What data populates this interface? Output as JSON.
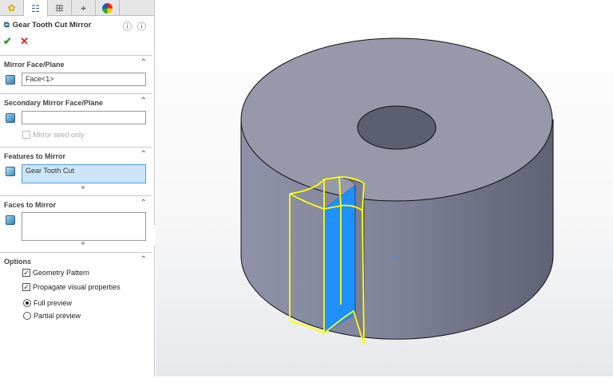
{
  "tabs": [
    {
      "name": "feature-manager",
      "icon": "gear-part-icon"
    },
    {
      "name": "property-manager",
      "icon": "list-icon",
      "active": true
    },
    {
      "name": "configuration-manager",
      "icon": "config-icon"
    },
    {
      "name": "dimxpert",
      "icon": "crosshair-icon"
    },
    {
      "name": "display-manager",
      "icon": "color-wheel-icon"
    }
  ],
  "title": "Gear Tooth Cut Mirror",
  "sections": {
    "mirror_face": {
      "header": "Mirror Face/Plane",
      "value": "Face<1>"
    },
    "secondary": {
      "header": "Secondary Mirror Face/Plane",
      "value": "",
      "option": "Mirror seed only"
    },
    "features": {
      "header": "Features to Mirror",
      "value": "Gear Tooth Cut"
    },
    "faces": {
      "header": "Faces to Mirror",
      "value": ""
    },
    "options": {
      "header": "Options",
      "geometry_pattern": "Geometry Pattern",
      "propagate": "Propagate visual properties",
      "full": "Full preview",
      "partial": "Partial preview"
    }
  },
  "state": {
    "geometry_pattern": true,
    "propagate": true,
    "mirror_seed_only": false,
    "preview": "full"
  },
  "colors": {
    "model": "#8a8d9e",
    "highlight": "#1e90ff",
    "preview_outline": "#ffff00"
  }
}
